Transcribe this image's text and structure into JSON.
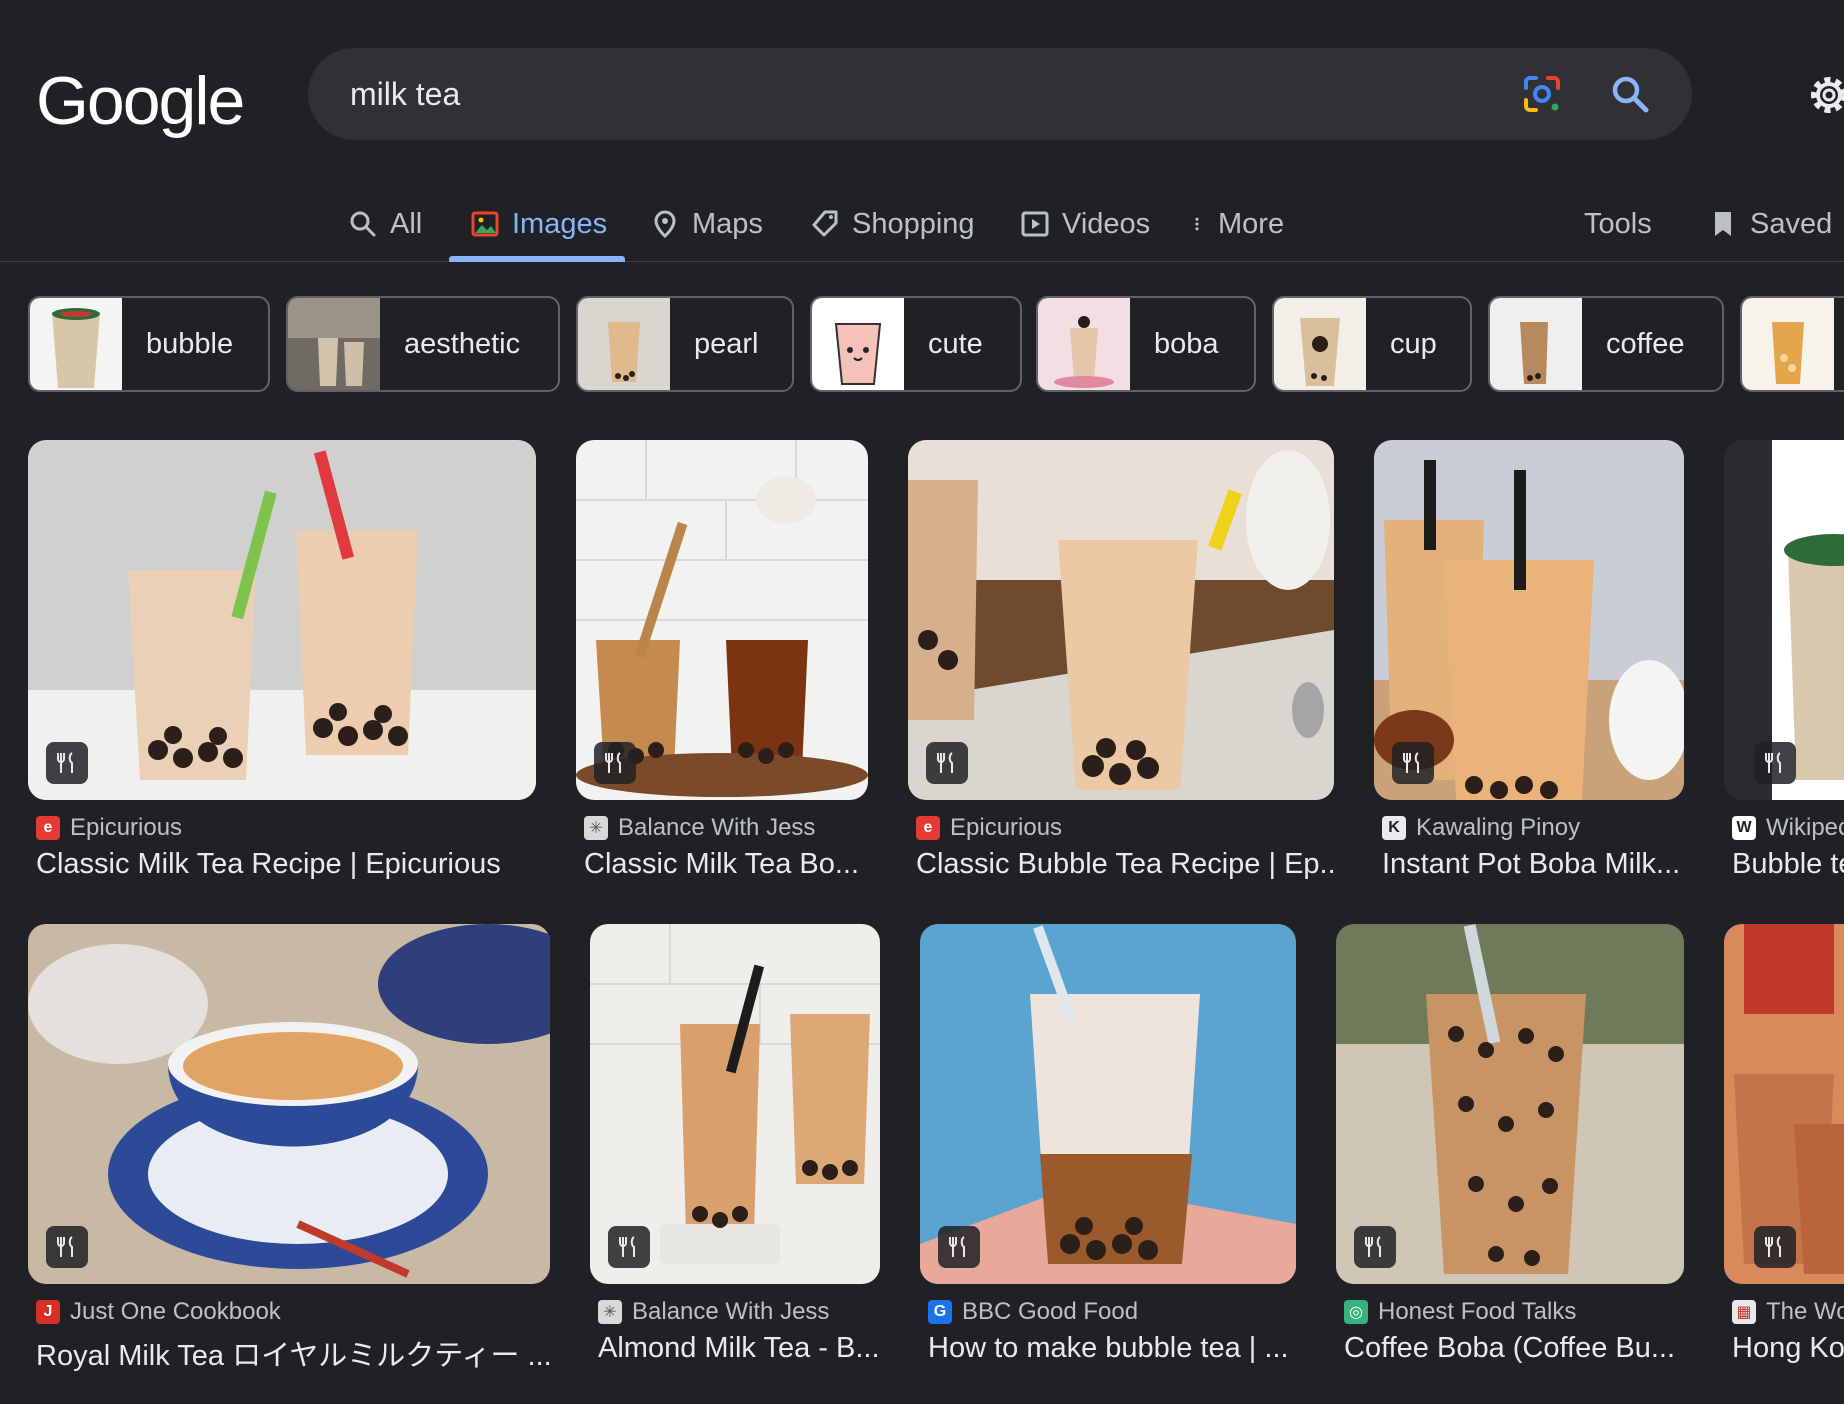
{
  "logo": {
    "text": "Google"
  },
  "search": {
    "query": "milk tea",
    "lens_icon": "google-lens-icon",
    "search_icon": "search-icon"
  },
  "header": {
    "settings_icon": "gear-icon"
  },
  "tabs": [
    {
      "label": "All",
      "icon": "search-icon"
    },
    {
      "label": "Images",
      "icon": "image-icon",
      "active": true
    },
    {
      "label": "Maps",
      "icon": "map-pin-icon"
    },
    {
      "label": "Shopping",
      "icon": "tag-icon"
    },
    {
      "label": "Videos",
      "icon": "play-icon"
    },
    {
      "label": "More",
      "icon": "more-vertical-icon"
    }
  ],
  "tools_label": "Tools",
  "saved_label": "Saved",
  "chips": [
    "bubble",
    "aesthetic",
    "pearl",
    "cute",
    "boba",
    "cup",
    "coffee"
  ],
  "results_row1": [
    {
      "source": "Epicurious",
      "title": "Classic Milk Tea Recipe | Epicurious"
    },
    {
      "source": "Balance With Jess",
      "title": "Classic Milk Tea Bo..."
    },
    {
      "source": "Epicurious",
      "title": "Classic Bubble Tea Recipe | Ep..."
    },
    {
      "source": "Kawaling Pinoy",
      "title": "Instant Pot Boba Milk..."
    },
    {
      "source": "Wikipec",
      "title": "Bubble te"
    }
  ],
  "results_row2": [
    {
      "source": "Just One Cookbook",
      "title": "Royal Milk Tea ロイヤルミルクティー ..."
    },
    {
      "source": "Balance With Jess",
      "title": "Almond Milk Tea - B..."
    },
    {
      "source": "BBC Good Food",
      "title": "How to make bubble tea | ..."
    },
    {
      "source": "Honest Food Talks",
      "title": "Coffee Boba (Coffee Bu..."
    },
    {
      "source": "The Wo",
      "title": "Hong Ko"
    }
  ],
  "colors": {
    "background": "#202124",
    "active_tab": "#8ab4f8",
    "text": "#e8eaed",
    "muted": "#bdc1c6"
  }
}
